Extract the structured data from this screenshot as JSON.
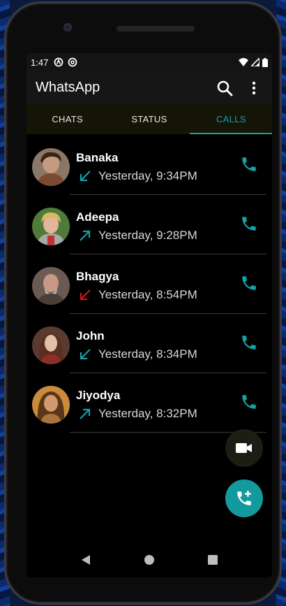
{
  "status_bar": {
    "time": "1:47",
    "icons": [
      "a-circle-icon",
      "p-circle-icon",
      "wifi-icon",
      "signal-icon",
      "battery-icon"
    ]
  },
  "app_bar": {
    "title": "WhatsApp",
    "icons": [
      "search-icon",
      "more-vert-icon"
    ]
  },
  "tabs": [
    {
      "label": "CHATS",
      "active": false
    },
    {
      "label": "STATUS",
      "active": false
    },
    {
      "label": "CALLS",
      "active": true
    }
  ],
  "calls": [
    {
      "name": "Banaka",
      "time": "Yesterday, 9:34PM",
      "direction": "incoming",
      "status": "received"
    },
    {
      "name": "Adeepa",
      "time": "Yesterday, 9:28PM",
      "direction": "outgoing",
      "status": "made"
    },
    {
      "name": "Bhagya",
      "time": "Yesterday, 8:54PM",
      "direction": "incoming",
      "status": "missed"
    },
    {
      "name": "John",
      "time": "Yesterday, 8:34PM",
      "direction": "incoming",
      "status": "received"
    },
    {
      "name": "Jiyodya",
      "time": "Yesterday, 8:32PM",
      "direction": "outgoing",
      "status": "made"
    }
  ],
  "fabs": {
    "video": "video-call-icon",
    "new_call": "add-call-icon"
  },
  "nav": [
    "back-icon",
    "home-icon",
    "recents-icon"
  ],
  "colors": {
    "accent": "#14a1a9",
    "missed": "#d01616",
    "fab_call_bg": "#139a9d",
    "fab_video_bg": "#1d1d13",
    "appbar_bg": "#161616",
    "tabs_bg": "#141407"
  }
}
